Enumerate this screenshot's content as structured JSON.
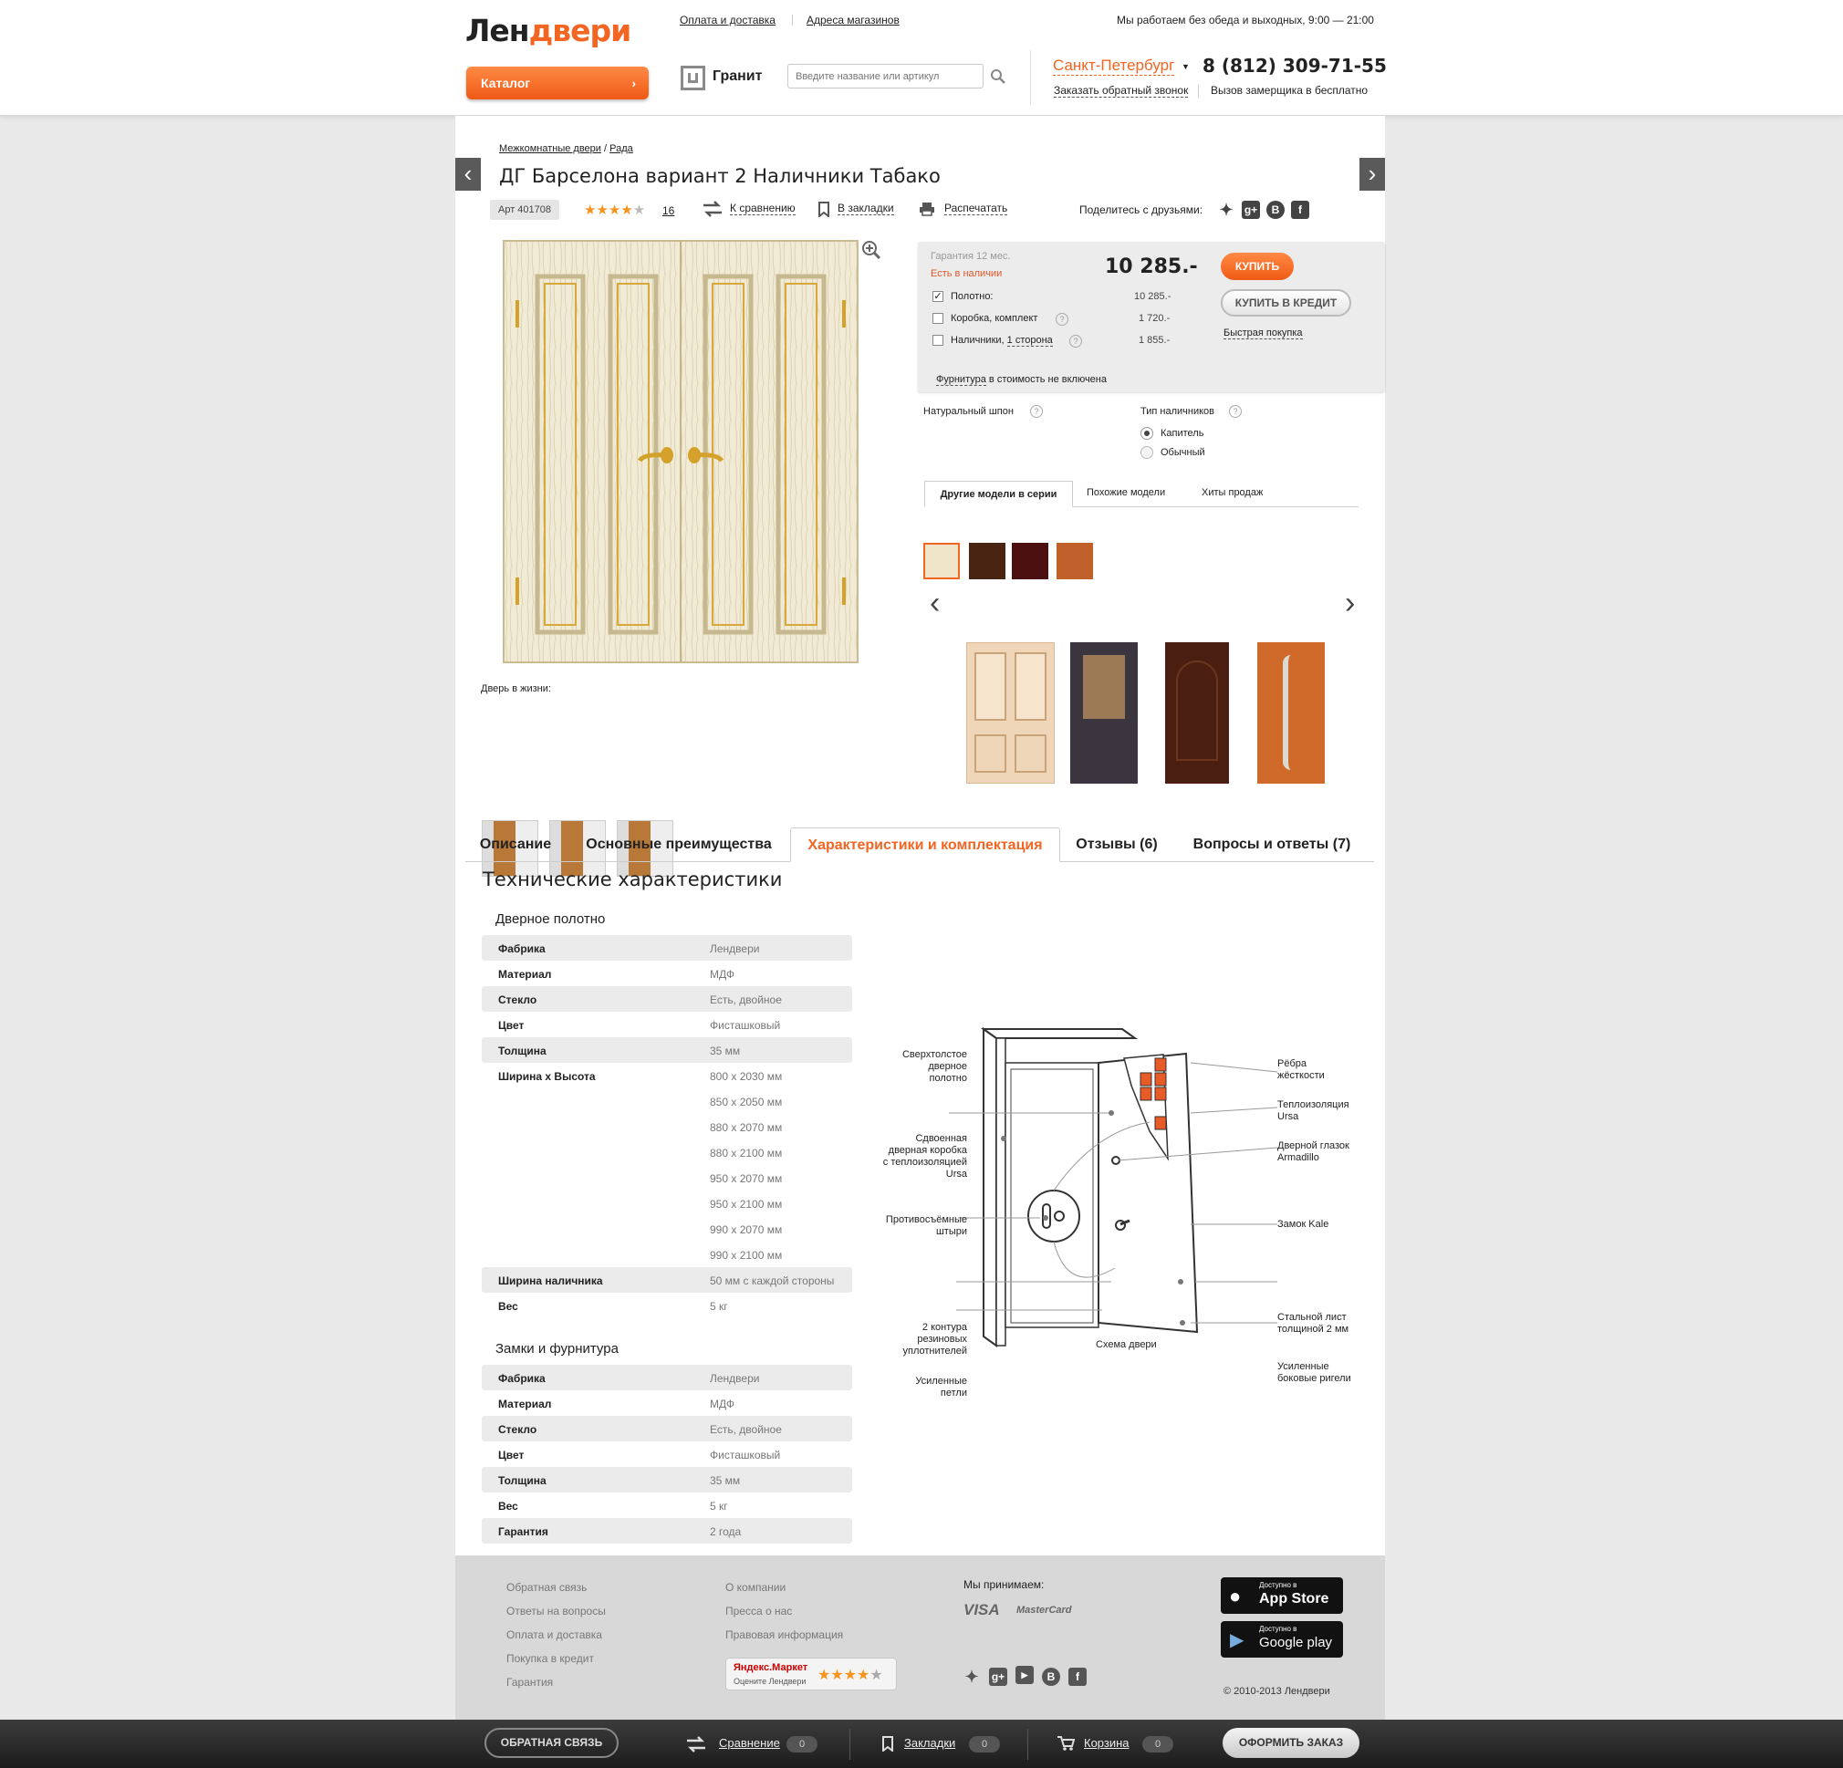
{
  "header": {
    "logo_dark": "Лен",
    "logo_orange": "двери",
    "catalog_label": "Каталог",
    "nav_links": [
      "Оплата и доставка",
      "Адреса магазинов"
    ],
    "hours": "Мы работаем без обеда и выходных, 9:00 — 21:00",
    "brand_name": "Гранит",
    "search_placeholder": "Введите название или артикул",
    "city": "Санкт-Петербург",
    "phone": "8 (812) 309-71-55",
    "callback_label": "Заказать обратный звонок",
    "measurer_text": "Вызов замерщика в бесплатно"
  },
  "product": {
    "breadcrumb": [
      "Межкомнатные двери",
      "Рада"
    ],
    "breadcrumb_sep": "/",
    "title": "ДГ Барселона вариант 2 Наличники Табако",
    "article": "Арт 401708",
    "rating": 4,
    "rating_stars": "★★★★",
    "rating_empty": "★",
    "reviews_count": "16",
    "compare_label": "К сравнению",
    "bookmark_label": "В закладки",
    "print_label": "Распечатать",
    "share_label": "Поделитесь с друзьями:",
    "life_label": "Дверь в жизни:"
  },
  "price_box": {
    "warranty": "Гарантия 12 мес.",
    "availability": "Есть в наличии",
    "price": "10 285.-",
    "buy_label": "КУПИТЬ",
    "credit_label": "КУПИТЬ В КРЕДИТ",
    "quick_buy": "Быстрая покупка",
    "options": [
      {
        "label": "Полотно:",
        "price": "10 285.-",
        "checked": true
      },
      {
        "label": "Коробка, комплект",
        "price": "1 720.-",
        "checked": false
      },
      {
        "label": "Наличники,",
        "link": "1 сторона",
        "price": "1 855.-",
        "checked": false
      }
    ],
    "note_link": "Фурнитура",
    "note_rest": " в стоимость не включена"
  },
  "options": {
    "veneer_label": "Натуральный шпон",
    "veneer_colors": [
      "#efe5c8",
      "#4a2412",
      "#4b0f0f",
      "#c0602a"
    ],
    "casing_label": "Тип наличников",
    "casing_types": [
      {
        "label": "Капитель",
        "selected": true
      },
      {
        "label": "Обычный",
        "selected": false
      }
    ]
  },
  "related_tabs": [
    "Другие модели в серии",
    "Похожие модели",
    "Хиты продаж"
  ],
  "main_tabs": [
    "Описание",
    "Основные преимущества",
    "Характеристики и комплектация",
    "Отзывы (6)",
    "Вопросы и ответы (7)"
  ],
  "specs": {
    "heading": "Технические характеристики",
    "door_section": "Дверное полотно",
    "door_rows": [
      {
        "k": "Фабрика",
        "v": "Лендвери"
      },
      {
        "k": "Материал",
        "v": "МДФ"
      },
      {
        "k": "Стекло",
        "v": "Есть, двойное"
      },
      {
        "k": "Цвет",
        "v": "Фисташковый"
      },
      {
        "k": "Толщина",
        "v": "35 мм"
      },
      {
        "k": "Ширина х Высота",
        "v": "800 х 2030 мм"
      },
      {
        "k": "",
        "v": "850 х 2050 мм"
      },
      {
        "k": "",
        "v": "880 х 2070 мм"
      },
      {
        "k": "",
        "v": "880 х 2100 мм"
      },
      {
        "k": "",
        "v": "950 х 2070 мм"
      },
      {
        "k": "",
        "v": "950 х 2100 мм"
      },
      {
        "k": "",
        "v": "990 х 2070 мм"
      },
      {
        "k": "",
        "v": "990 х 2100 мм"
      },
      {
        "k": "Ширина наличника",
        "v": "50 мм с каждой стороны"
      },
      {
        "k": "Вес",
        "v": "5 кг"
      }
    ],
    "locks_section": "Замки и фурнитура",
    "locks_rows": [
      {
        "k": "Фабрика",
        "v": "Лендвери"
      },
      {
        "k": "Материал",
        "v": "МДФ"
      },
      {
        "k": "Стекло",
        "v": "Есть, двойное"
      },
      {
        "k": "Цвет",
        "v": "Фисташковый"
      },
      {
        "k": "Толщина",
        "v": "35 мм"
      },
      {
        "k": "Вес",
        "v": "5 кг"
      },
      {
        "k": "Гарантия",
        "v": "2 года"
      }
    ]
  },
  "diagram": {
    "caption": "Схема двери",
    "left_labels": [
      "Сверхтолстое\nдверное\nполотно",
      "Сдвоенная\nдверная коробка\nс теплоизоляцией\nUrsa",
      "Противосъёмные\nштыри",
      "2 контура\nрезиновых\nуплотнителей",
      "Усиленные\nпетли"
    ],
    "right_labels": [
      "Рёбра\nжёсткости",
      "Теплоизоляция\nUrsa",
      "Дверной глазок\nArmadillo",
      "Замок Kale",
      "Стальной лист\nтолщиной 2 мм",
      "Усиленные\nбоковые ригели"
    ]
  },
  "footer": {
    "col1": [
      "Обратная связь",
      "Ответы на вопросы",
      "Оплата и доставка",
      "Покупка в кредит",
      "Гарантия"
    ],
    "col2": [
      "О компании",
      "Пресса о нас",
      "Правовая информация"
    ],
    "accept_label": "Мы принимаем:",
    "visa": "VISA",
    "mastercard": "MasterCard",
    "market_title": "Яндекс.Маркет",
    "market_sub": "Оцените Лендвери",
    "market_stars": "★★★★",
    "market_empty": "★",
    "appstore_small": "Доступно в",
    "appstore_big": "App Store",
    "gplay_small": "Доступно в",
    "gplay_big": "Google play",
    "copyright": "© 2010-2013 Лендвери"
  },
  "bottombar": {
    "feedback_label": "ОБРАТНАЯ СВЯЗЬ",
    "compare_label": "Сравнение",
    "compare_count": "0",
    "bookmarks_label": "Закладки",
    "bookmarks_count": "0",
    "cart_label": "Корзина",
    "cart_count": "0",
    "checkout_label": "ОФОРМИТЬ ЗАКАЗ"
  },
  "colors": {
    "accent": "#f26522",
    "availability": "#e2562a"
  }
}
